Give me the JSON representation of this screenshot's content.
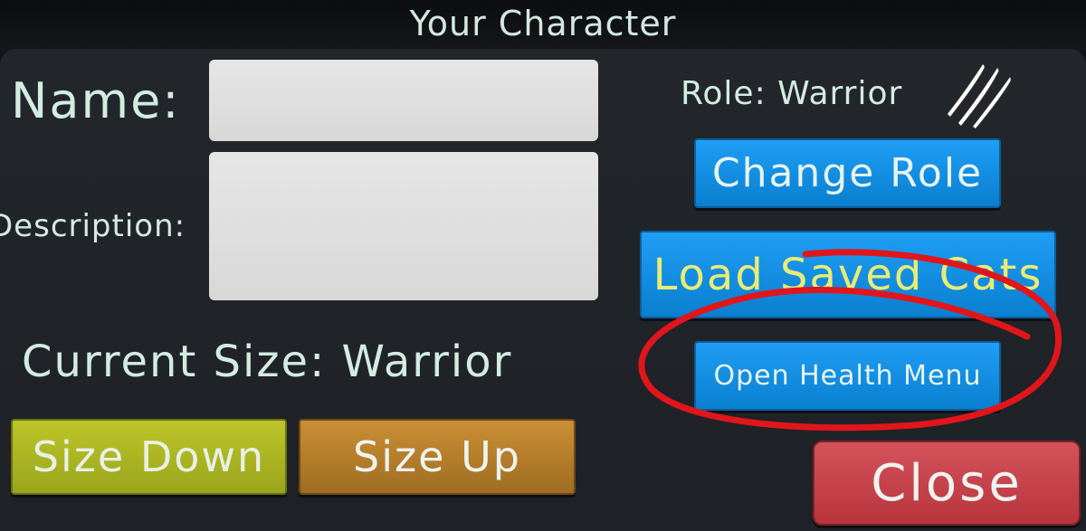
{
  "window": {
    "title": "Your Character"
  },
  "form": {
    "name_label": "Name:",
    "name_value": "",
    "description_label": "Description:",
    "description_value": ""
  },
  "size": {
    "label": "Current Size: Warrior",
    "size_down_label": "Size Down",
    "size_up_label": "Size Up"
  },
  "role": {
    "label": "Role: Warrior",
    "icon": "claw-marks-icon",
    "change_role_label": "Change Role"
  },
  "actions": {
    "load_saved_cats_label": "Load Saved Cats",
    "open_health_menu_label": "Open Health Menu",
    "close_label": "Close"
  },
  "annotation": {
    "type": "hand-drawn-circle",
    "color": "#e0161c",
    "target": "open-health-menu-button"
  },
  "colors": {
    "blue_button": "#1a94e8",
    "size_down_button": "#afb924",
    "size_up_button": "#b9822e",
    "close_button": "#c9454d",
    "load_saved_text": "#e9ec74",
    "label_text": "#d3ece2"
  }
}
